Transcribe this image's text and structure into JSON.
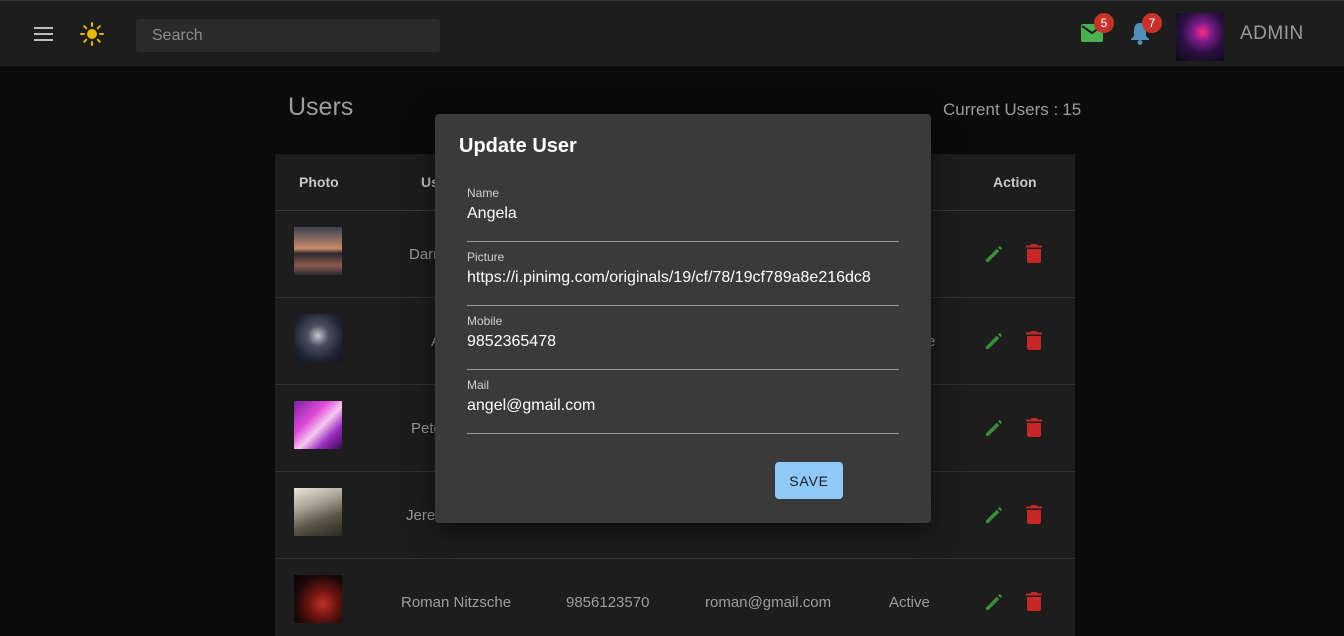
{
  "header": {
    "search_placeholder": "Search",
    "mail_count": "5",
    "notification_count": "7",
    "user_name": "ADMIN",
    "mail_color": "#4caf50",
    "bell_color": "#4f8fb8",
    "sun_color": "#e6b800"
  },
  "page": {
    "title": "Users",
    "current_users_label": "Current Users :",
    "current_users_count": "15"
  },
  "table": {
    "columns": {
      "photo": "Photo",
      "user_partial": "Us",
      "action": "Action"
    },
    "rows": [
      {
        "name": "Darr",
        "mobile": "",
        "email": "",
        "status": ""
      },
      {
        "name": "A",
        "mobile": "",
        "email": "",
        "status": "e"
      },
      {
        "name": "Pete",
        "mobile": "",
        "email": "",
        "status": ""
      },
      {
        "name": "Jere",
        "mobile": "",
        "email": "",
        "status": ""
      },
      {
        "name": "Roman Nitzsche",
        "mobile": "9856123570",
        "email": "roman@gmail.com",
        "status": "Active"
      }
    ],
    "edit_color": "#388e3c",
    "delete_color": "#c62828"
  },
  "dialog": {
    "title": "Update User",
    "fields": [
      {
        "label": "Name",
        "value": "Angela"
      },
      {
        "label": "Picture",
        "value": "https://i.pinimg.com/originals/19/cf/78/19cf789a8e216dc8"
      },
      {
        "label": "Mobile",
        "value": "9852365478"
      },
      {
        "label": "Mail",
        "value": "angel@gmail.com"
      }
    ],
    "save_label": "SAVE"
  }
}
